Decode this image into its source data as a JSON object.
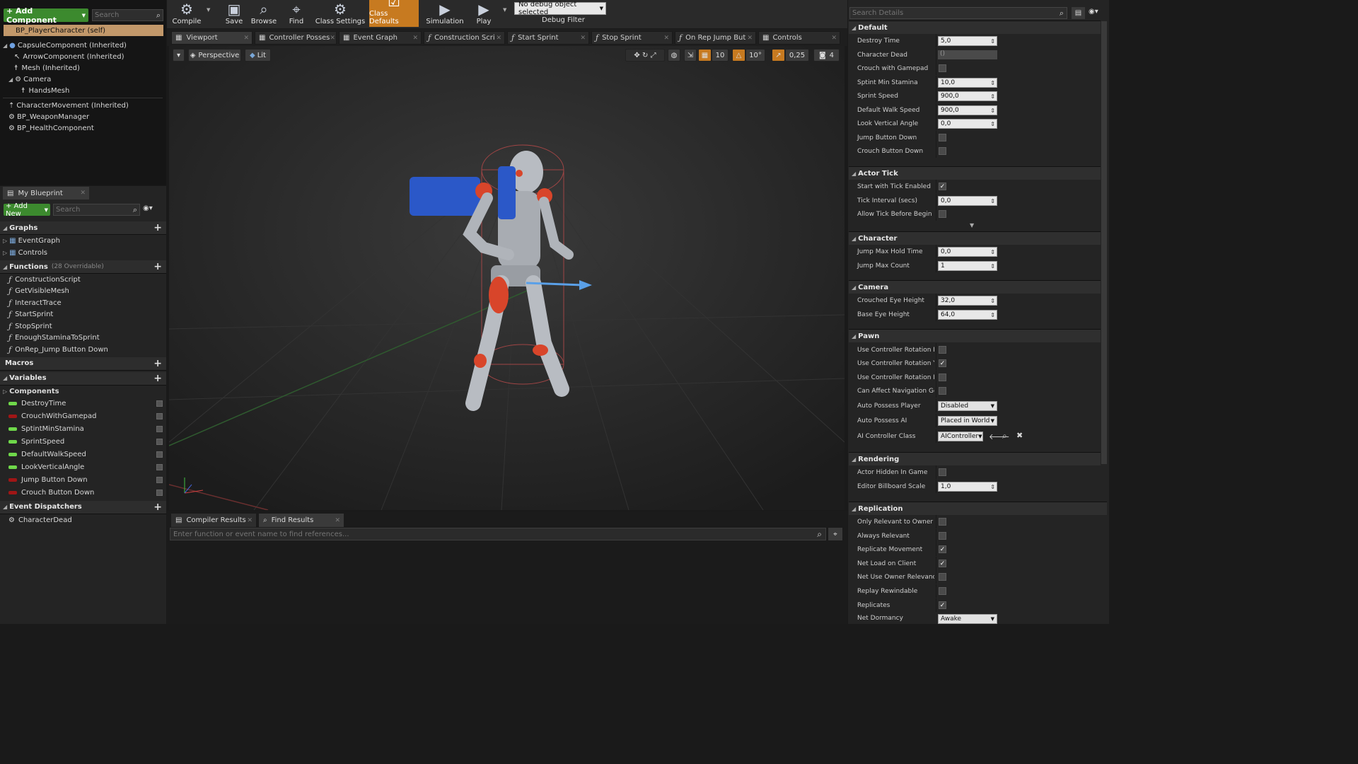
{
  "toolbar": {
    "add_component": "+ Add Component",
    "search_placeholder": "Search",
    "buttons": [
      "Compile",
      "Save",
      "Browse",
      "Find",
      "Class Settings",
      "Class Defaults",
      "Simulation",
      "Play"
    ],
    "debug_select": "No debug object selected",
    "debug_filter": "Debug Filter"
  },
  "components": {
    "self": "BP_PlayerCharacter (self)",
    "tree": [
      "CapsuleComponent (Inherited)",
      "ArrowComponent (Inherited)",
      "Mesh (Inherited)",
      "Camera",
      "HandsMesh",
      "CharacterMovement (Inherited)",
      "BP_WeaponManager",
      "BP_HealthComponent"
    ]
  },
  "my_blueprint": {
    "tab": "My Blueprint",
    "add_new": "+ Add New",
    "search_placeholder": "Search",
    "graphs_header": "Graphs",
    "graphs": [
      "EventGraph",
      "Controls"
    ],
    "functions_header": "Functions",
    "functions_note": "(28 Overridable)",
    "functions": [
      "ConstructionScript",
      "GetVisibleMesh",
      "InteractTrace",
      "StartSprint",
      "StopSprint",
      "EnoughStaminaToSprint",
      "OnRep_Jump Button Down"
    ],
    "macros_header": "Macros",
    "variables_header": "Variables",
    "components_header": "Components",
    "variables": [
      {
        "name": "DestroyTime",
        "color": "#6fd84a"
      },
      {
        "name": "CrouchWithGamepad",
        "color": "#a01616"
      },
      {
        "name": "SptintMinStamina",
        "color": "#6fd84a"
      },
      {
        "name": "SprintSpeed",
        "color": "#6fd84a"
      },
      {
        "name": "DefaultWalkSpeed",
        "color": "#6fd84a"
      },
      {
        "name": "LookVerticalAngle",
        "color": "#6fd84a"
      },
      {
        "name": "Jump Button Down",
        "color": "#a01616"
      },
      {
        "name": "Crouch Button Down",
        "color": "#a01616"
      }
    ],
    "dispatchers_header": "Event Dispatchers",
    "dispatchers": [
      "CharacterDead"
    ]
  },
  "editor_tabs": [
    "Viewport",
    "Controller Posses",
    "Event Graph",
    "Construction Scri",
    "Start Sprint",
    "Stop Sprint",
    "On Rep Jump But",
    "Controls"
  ],
  "viewport": {
    "perspective": "Perspective",
    "lit": "Lit",
    "grid_snap": "10",
    "rot_snap": "10°",
    "scale_snap": "0,25",
    "cam_speed": "4"
  },
  "bottom": {
    "tabs": [
      "Compiler Results",
      "Find Results"
    ],
    "find_placeholder": "Enter function or event name to find references..."
  },
  "details": {
    "search_placeholder": "Search Details",
    "default": {
      "header": "Default",
      "destroy_time_label": "Destroy Time",
      "destroy_time": "5,0",
      "character_dead_label": "Character Dead",
      "character_dead": "()",
      "crouch_gamepad_label": "Crouch with Gamepad",
      "sprint_min_label": "Sptint Min Stamina",
      "sprint_min": "10,0",
      "sprint_speed_label": "Sprint Speed",
      "sprint_speed": "900,0",
      "walk_speed_label": "Default Walk Speed",
      "walk_speed": "900,0",
      "look_angle_label": "Look Vertical Angle",
      "look_angle": "0,0",
      "jump_down_label": "Jump Button Down",
      "crouch_down_label": "Crouch Button Down"
    },
    "actor_tick": {
      "header": "Actor Tick",
      "start_tick_label": "Start with Tick Enabled",
      "tick_interval_label": "Tick Interval (secs)",
      "tick_interval": "0,0",
      "allow_tick_label": "Allow Tick Before Begin Pla"
    },
    "character": {
      "header": "Character",
      "jump_hold_label": "Jump Max Hold Time",
      "jump_hold": "0,0",
      "jump_count_label": "Jump Max Count",
      "jump_count": "1"
    },
    "camera": {
      "header": "Camera",
      "crouch_eye_label": "Crouched Eye Height",
      "crouch_eye": "32,0",
      "base_eye_label": "Base Eye Height",
      "base_eye": "64,0"
    },
    "pawn": {
      "header": "Pawn",
      "rot_pitch_label": "Use Controller Rotation Pitc",
      "rot_yaw_label": "Use Controller Rotation Yav",
      "rot_roll_label": "Use Controller Rotation Rol",
      "nav_label": "Can Affect Navigation Gene",
      "auto_player_label": "Auto Possess Player",
      "auto_player": "Disabled",
      "auto_ai_label": "Auto Possess AI",
      "auto_ai": "Placed in World",
      "ai_class_label": "AI Controller Class",
      "ai_class": "AIController"
    },
    "rendering": {
      "header": "Rendering",
      "hidden_label": "Actor Hidden In Game",
      "billboard_label": "Editor Billboard Scale",
      "billboard": "1,0"
    },
    "replication": {
      "header": "Replication",
      "owner_label": "Only Relevant to Owner",
      "always_label": "Always Relevant",
      "rep_move_label": "Replicate Movement",
      "net_load_label": "Net Load on Client",
      "net_owner_label": "Net Use Owner Relevancy",
      "replay_label": "Replay Rewindable",
      "replicates_label": "Replicates",
      "dormancy_label": "Net Dormancy",
      "dormancy": "Awake"
    }
  }
}
